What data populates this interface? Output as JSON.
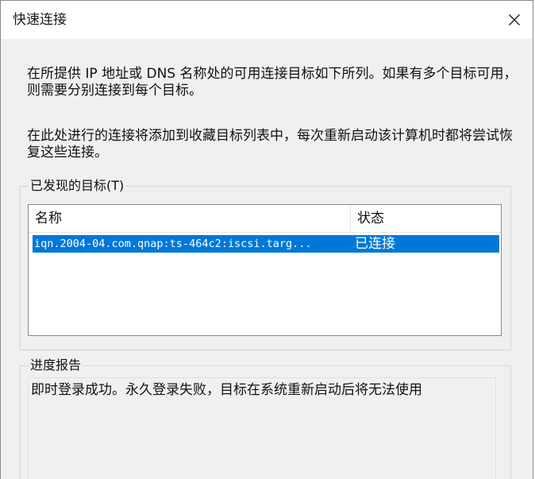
{
  "window": {
    "title": "快速连接",
    "close_icon": "close-icon"
  },
  "description": {
    "paragraph1": "在所提供 IP 地址或 DNS 名称处的可用连接目标如下所列。如果有多个目标可用，则需要分别连接到每个目标。",
    "paragraph2": "在此处进行的连接将添加到收藏目标列表中，每次重新启动该计算机时都将尝试恢复这些连接。"
  },
  "targets_group": {
    "label": "已发现的目标(T)",
    "columns": [
      "名称",
      "状态"
    ],
    "rows": [
      {
        "name": "iqn.2004-04.com.qnap:ts-464c2:iscsi.targ...",
        "status": "已连接",
        "selected": true
      }
    ],
    "selection_color": "#0078d7"
  },
  "progress_group": {
    "label": "进度报告",
    "text": "即时登录成功。永久登录失败，目标在系统重新启动后将无法使用"
  }
}
